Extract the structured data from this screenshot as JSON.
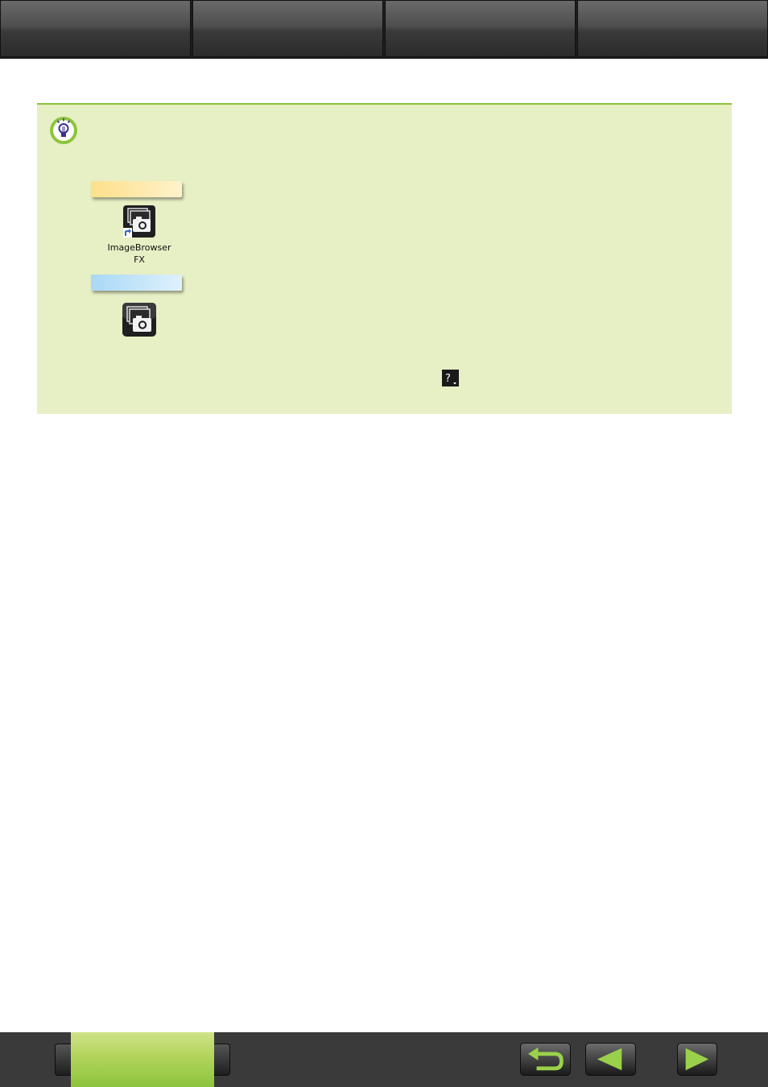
{
  "top_nav": {
    "tabs": [
      {
        "label": ""
      },
      {
        "label": ""
      },
      {
        "label": ""
      },
      {
        "label": ""
      }
    ]
  },
  "hint_panel": {
    "icon": "lightbulb-icon",
    "shortcut_label_line1": "ImageBrowser",
    "shortcut_label_line2": "FX",
    "help_icon_text": "?"
  },
  "bottom_bar": {
    "home_label": "",
    "back_icon": "return-arrow-icon",
    "prev_icon": "triangle-left-icon",
    "next_icon": "triangle-right-icon"
  },
  "colors": {
    "accent_green": "#8cc43d",
    "panel_bg": "#e7efc4"
  }
}
